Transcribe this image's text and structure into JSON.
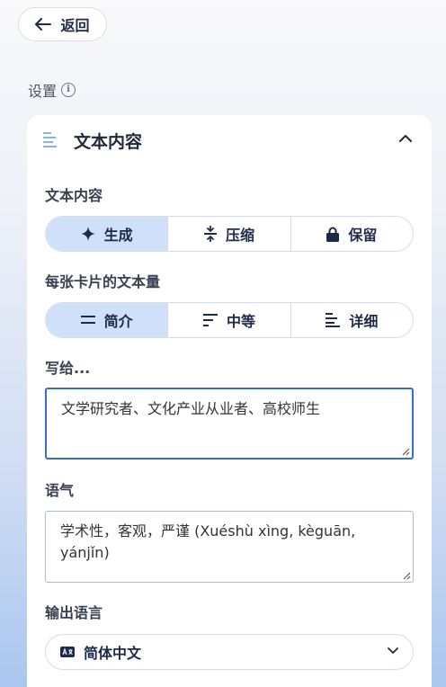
{
  "back": {
    "label": "返回",
    "icon": "arrow-left-icon"
  },
  "settings": {
    "label": "设置",
    "info_icon": "info-icon"
  },
  "card": {
    "title": "文本内容",
    "icon": "document-lines-icon",
    "collapse_icon": "chevron-up-icon"
  },
  "text_content": {
    "label": "文本内容",
    "options": [
      {
        "label": "生成",
        "icon": "sparkle-icon",
        "selected": true
      },
      {
        "label": "压缩",
        "icon": "compress-icon",
        "selected": false
      },
      {
        "label": "保留",
        "icon": "lock-icon",
        "selected": false
      }
    ]
  },
  "amount": {
    "label": "每张卡片的文本量",
    "options": [
      {
        "label": "简介",
        "icon": "lines-short-icon",
        "selected": true
      },
      {
        "label": "中等",
        "icon": "lines-medium-icon",
        "selected": false
      },
      {
        "label": "详细",
        "icon": "lines-detailed-icon",
        "selected": false
      }
    ]
  },
  "audience": {
    "label": "写给...",
    "value": "文学研究者、文化产业从业者、高校师生"
  },
  "tone": {
    "label": "语气",
    "value": "学术性，客观，严谨 (Xuéshù xìng, kèguān, yánjǐn)"
  },
  "output_language": {
    "label": "输出语言",
    "value": "简体中文",
    "icon": "translate-icon",
    "chevron": "chevron-down-icon"
  },
  "colors": {
    "accent": "#3a6fc9",
    "active_segment": "#cfe0fa",
    "text_dark": "#1e2a4a"
  }
}
